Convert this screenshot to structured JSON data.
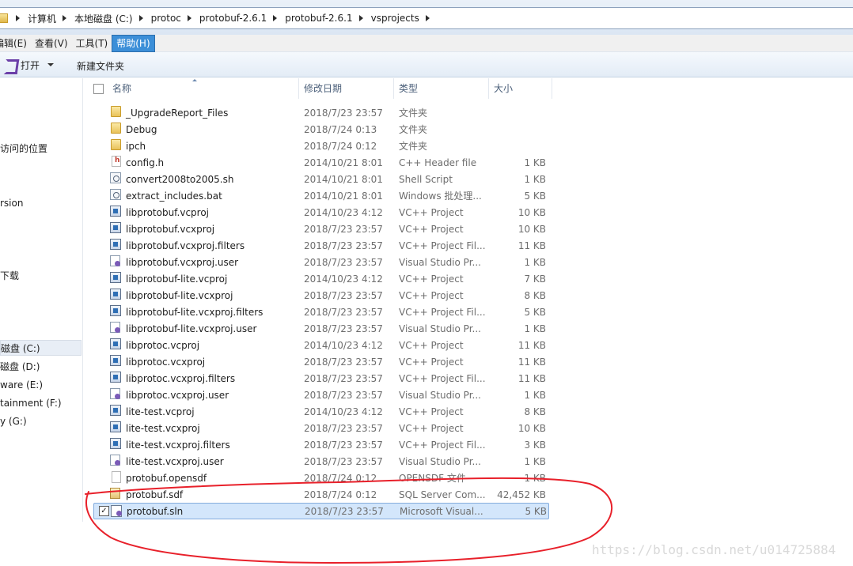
{
  "breadcrumb": [
    "计算机",
    "本地磁盘 (C:)",
    "protoc",
    "protobuf-2.6.1",
    "protobuf-2.6.1",
    "vsprojects"
  ],
  "menu": [
    "编辑(E)",
    "查看(V)",
    "工具(T)",
    "帮助(H)"
  ],
  "menu_active": "帮助(H)",
  "commands": {
    "open": "打开",
    "new_folder": "新建文件夹"
  },
  "nav": [
    "访问的位置",
    "rsion",
    "下载",
    "磁盘 (C:)",
    "磁盘 (D:)",
    "ware (E:)",
    "tainment (F:)",
    "y (G:)"
  ],
  "columns": {
    "name": "名称",
    "date": "修改日期",
    "type": "类型",
    "size": "大小"
  },
  "files": [
    {
      "name": "_UpgradeReport_Files",
      "date": "2018/7/23 23:57",
      "type": "文件夹",
      "size": "",
      "icon": "folder-icon"
    },
    {
      "name": "Debug",
      "date": "2018/7/24 0:13",
      "type": "文件夹",
      "size": "",
      "icon": "folder-icon"
    },
    {
      "name": "ipch",
      "date": "2018/7/24 0:12",
      "type": "文件夹",
      "size": "",
      "icon": "folder-icon"
    },
    {
      "name": "config.h",
      "date": "2014/10/21 8:01",
      "type": "C++ Header file",
      "size": "1 KB",
      "icon": "header-file-icon"
    },
    {
      "name": "convert2008to2005.sh",
      "date": "2014/10/21 8:01",
      "type": "Shell Script",
      "size": "1 KB",
      "icon": "script-file-icon"
    },
    {
      "name": "extract_includes.bat",
      "date": "2014/10/21 8:01",
      "type": "Windows 批处理...",
      "size": "5 KB",
      "icon": "script-file-icon"
    },
    {
      "name": "libprotobuf.vcproj",
      "date": "2014/10/23 4:12",
      "type": "VC++ Project",
      "size": "10 KB",
      "icon": "project-file-icon"
    },
    {
      "name": "libprotobuf.vcxproj",
      "date": "2018/7/23 23:57",
      "type": "VC++ Project",
      "size": "10 KB",
      "icon": "project-file-icon"
    },
    {
      "name": "libprotobuf.vcxproj.filters",
      "date": "2018/7/23 23:57",
      "type": "VC++ Project Fil...",
      "size": "11 KB",
      "icon": "project-file-icon"
    },
    {
      "name": "libprotobuf.vcxproj.user",
      "date": "2018/7/23 23:57",
      "type": "Visual Studio Pr...",
      "size": "1 KB",
      "icon": "user-file-icon"
    },
    {
      "name": "libprotobuf-lite.vcproj",
      "date": "2014/10/23 4:12",
      "type": "VC++ Project",
      "size": "7 KB",
      "icon": "project-file-icon"
    },
    {
      "name": "libprotobuf-lite.vcxproj",
      "date": "2018/7/23 23:57",
      "type": "VC++ Project",
      "size": "8 KB",
      "icon": "project-file-icon"
    },
    {
      "name": "libprotobuf-lite.vcxproj.filters",
      "date": "2018/7/23 23:57",
      "type": "VC++ Project Fil...",
      "size": "5 KB",
      "icon": "project-file-icon"
    },
    {
      "name": "libprotobuf-lite.vcxproj.user",
      "date": "2018/7/23 23:57",
      "type": "Visual Studio Pr...",
      "size": "1 KB",
      "icon": "user-file-icon"
    },
    {
      "name": "libprotoc.vcproj",
      "date": "2014/10/23 4:12",
      "type": "VC++ Project",
      "size": "11 KB",
      "icon": "project-file-icon"
    },
    {
      "name": "libprotoc.vcxproj",
      "date": "2018/7/23 23:57",
      "type": "VC++ Project",
      "size": "11 KB",
      "icon": "project-file-icon"
    },
    {
      "name": "libprotoc.vcxproj.filters",
      "date": "2018/7/23 23:57",
      "type": "VC++ Project Fil...",
      "size": "11 KB",
      "icon": "project-file-icon"
    },
    {
      "name": "libprotoc.vcxproj.user",
      "date": "2018/7/23 23:57",
      "type": "Visual Studio Pr...",
      "size": "1 KB",
      "icon": "user-file-icon"
    },
    {
      "name": "lite-test.vcproj",
      "date": "2014/10/23 4:12",
      "type": "VC++ Project",
      "size": "8 KB",
      "icon": "project-file-icon"
    },
    {
      "name": "lite-test.vcxproj",
      "date": "2018/7/23 23:57",
      "type": "VC++ Project",
      "size": "10 KB",
      "icon": "project-file-icon"
    },
    {
      "name": "lite-test.vcxproj.filters",
      "date": "2018/7/23 23:57",
      "type": "VC++ Project Fil...",
      "size": "3 KB",
      "icon": "project-file-icon"
    },
    {
      "name": "lite-test.vcxproj.user",
      "date": "2018/7/23 23:57",
      "type": "Visual Studio Pr...",
      "size": "1 KB",
      "icon": "user-file-icon"
    },
    {
      "name": "protobuf.opensdf",
      "date": "2018/7/24 0:12",
      "type": "OPENSDF 文件",
      "size": "1 KB",
      "icon": "blank-file-icon"
    },
    {
      "name": "protobuf.sdf",
      "date": "2018/7/24 0:12",
      "type": "SQL Server Com...",
      "size": "42,452 KB",
      "icon": "database-file-icon"
    },
    {
      "name": "protobuf.sln",
      "date": "2018/7/23 23:57",
      "type": "Microsoft Visual...",
      "size": "5 KB",
      "icon": "solution-file-icon",
      "selected": true,
      "checked": true
    }
  ],
  "colors": {
    "selection": "#d3e6fb",
    "annotation": "#e8202a",
    "menu_active": "#3c8fd8"
  },
  "watermark": "https://blog.csdn.net/u014725884"
}
